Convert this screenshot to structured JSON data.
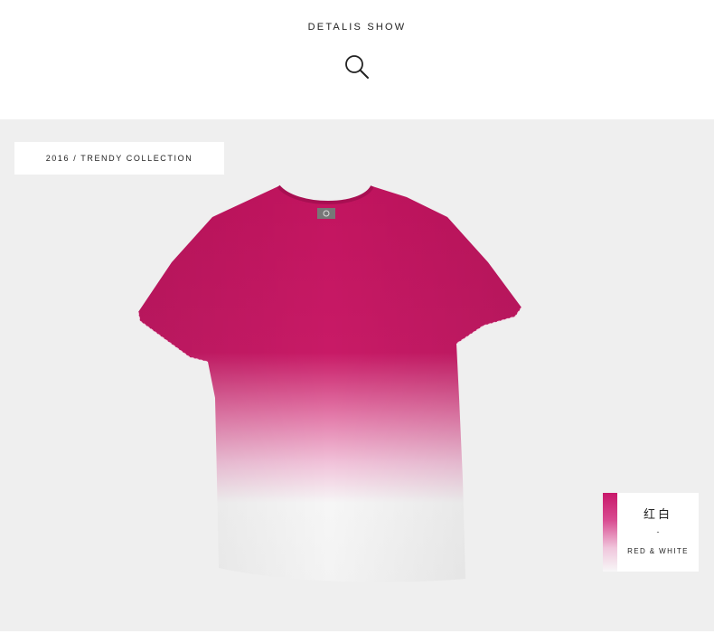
{
  "header": {
    "title": "DETALIS SHOW",
    "icon": "search-icon"
  },
  "collection": {
    "label": "2016 / TRENDY COLLECTION"
  },
  "product": {
    "image": "tshirt-gradient-image",
    "colors": {
      "top": "#c2145f",
      "mid": "#e37aa9",
      "bottom": "#f6f6f6"
    }
  },
  "color_card": {
    "name_cn": "红白",
    "separator": "-",
    "name_en": "RED & WHITE",
    "swatch_top": "#c8176a",
    "swatch_bottom": "#f7f7f7"
  },
  "theme": {
    "panel_bg": "#efefef",
    "text": "#222222"
  }
}
